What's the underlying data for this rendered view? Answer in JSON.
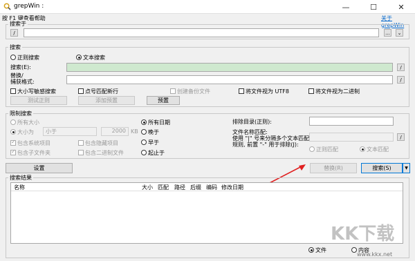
{
  "window": {
    "title": "grepWin :",
    "controls": {
      "minimize": "—",
      "maximize": "☐",
      "close": "✕"
    }
  },
  "top": {
    "help_hint": "按 F1 键查看帮助",
    "about_link": "关于grepWin"
  },
  "search_in": {
    "legend": "搜索于",
    "value": "",
    "left_btn": "/",
    "browse_btn": "...",
    "dropdown_btn": "⌄"
  },
  "search": {
    "legend": "搜索",
    "regex_radio": "正则搜索",
    "text_radio": "文本搜索",
    "search_label": "搜索(E):",
    "search_value": "",
    "replace_label_1": "替换/",
    "replace_label_2": "捕获格式:",
    "replace_value": "",
    "side_btn": "/",
    "case_sensitive": "大小写敏感搜索",
    "dot_newline": "点号匹配新行",
    "create_backup": "创建备份文件",
    "treat_utf8": "将文件视为 UTF8",
    "treat_binary": "将文件视为二进制",
    "test_regex_btn": "测试正则",
    "add_preset_btn": "添加预置",
    "preset_btn": "预置"
  },
  "limit": {
    "legend": "限制搜索",
    "all_sizes": "所有大小",
    "size_is": "大小为",
    "size_op": "小于",
    "size_value": "2000",
    "size_unit": "KB",
    "include_system": "包含系统项目",
    "include_hidden": "包含隐藏项目",
    "include_subfolders": "包含子文件夹",
    "include_binary": "包含二进制文件",
    "all_dates": "所有日期",
    "newer": "晚于",
    "older": "早于",
    "between": "起止于",
    "exclude_dirs_label": "排除目录(正则):",
    "exclude_dirs_value": "",
    "file_match_label_1": "文件名称匹配:",
    "file_match_label_2": "使用 \"|\" 号来分隔多个文本匹配",
    "file_match_label_3": "规则, 前置 \"-\" 用于排除(J):",
    "file_match_value": "",
    "regex_match": "正则匹配",
    "text_match": "文本匹配",
    "side_btn": "/"
  },
  "actions": {
    "settings_btn": "设置",
    "replace_btn": "替换(R)",
    "search_btn": "搜索(S)",
    "search_dropdown": "▼"
  },
  "results": {
    "legend": "搜索结果",
    "columns": [
      "名称",
      "大小",
      "匹配",
      "路径",
      "后缀",
      "编码",
      "修改日期"
    ],
    "show_files": "文件",
    "show_content": "内容"
  },
  "watermark": {
    "brand": "KK下载",
    "url": "www.kkx.net"
  },
  "colors": {
    "arrow": "#e02020",
    "search_green": "#cfe9cf",
    "link": "#0066cc"
  }
}
